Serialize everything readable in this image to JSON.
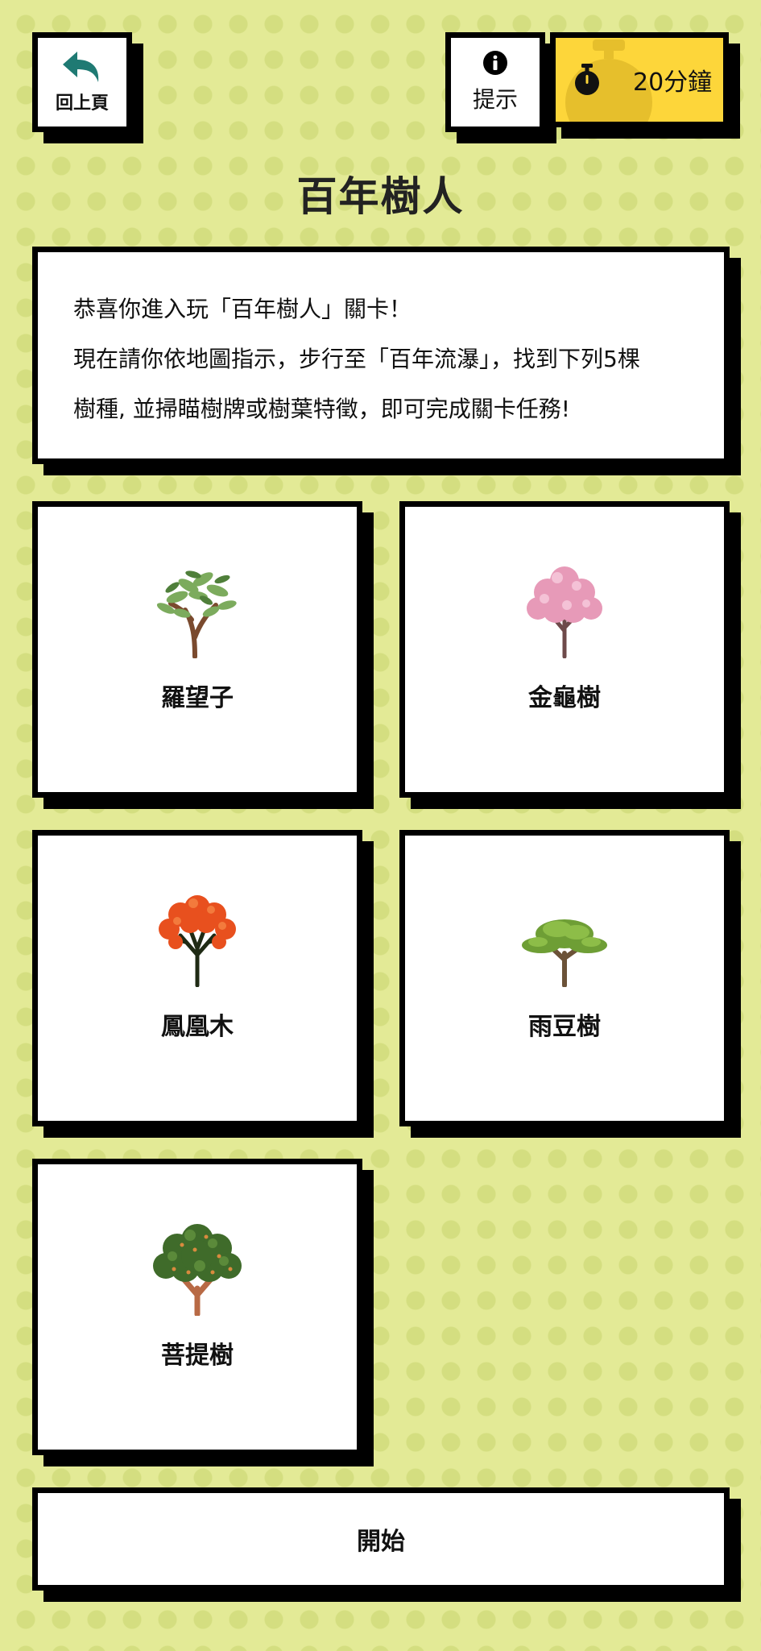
{
  "header": {
    "back_label": "回上頁",
    "hint_label": "提示",
    "timer_value": "20分鐘"
  },
  "title": "百年樹人",
  "intro": {
    "line1": "恭喜你進入玩「百年樹人」關卡！",
    "line2": "現在請你依地圖指示，步行至「百年流瀑」，找到下列5棵",
    "line3": "樹種, 並掃瞄樹牌或樹葉特徵，即可完成關卡任務!"
  },
  "trees": [
    {
      "name": "羅望子",
      "icon": "tamarind-tree-icon"
    },
    {
      "name": "金龜樹",
      "icon": "pink-blossom-tree-icon"
    },
    {
      "name": "鳳凰木",
      "icon": "flame-tree-icon"
    },
    {
      "name": "雨豆樹",
      "icon": "rain-tree-icon"
    },
    {
      "name": "菩提樹",
      "icon": "bodhi-tree-icon"
    }
  ],
  "start_label": "開始",
  "colors": {
    "background": "#e3ea96",
    "timer": "#fdd63a",
    "back_arrow": "#1f7a73",
    "border": "#000000"
  }
}
